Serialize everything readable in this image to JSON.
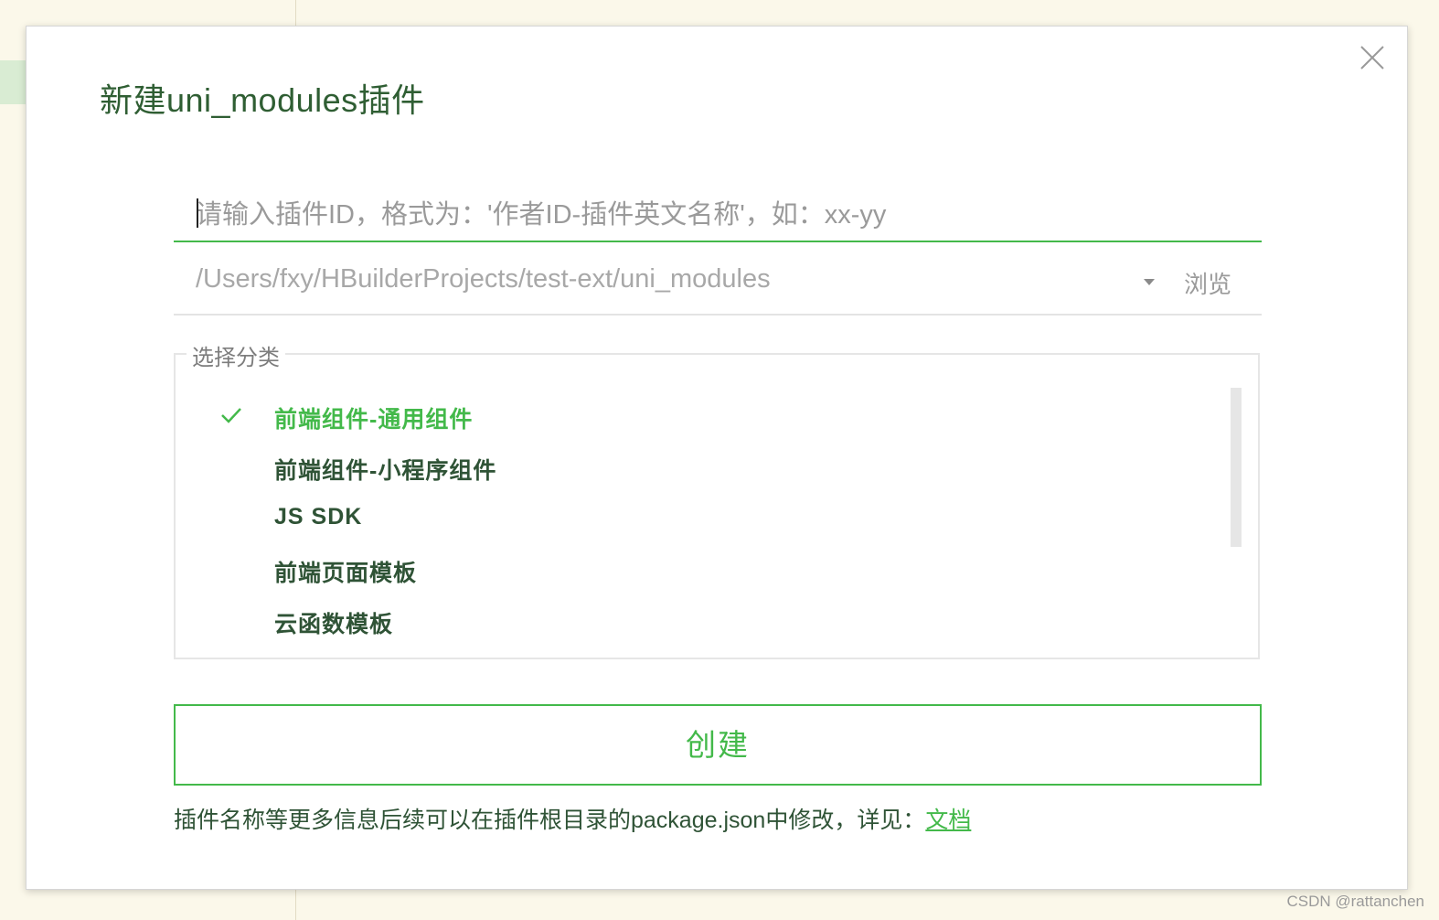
{
  "dialog": {
    "title": "新建uni_modules插件",
    "id_input": {
      "value": "",
      "placeholder": "请输入插件ID，格式为：'作者ID-插件英文名称'，如：xx-yy"
    },
    "path": {
      "value": "/Users/fxy/HBuilderProjects/test-ext/uni_modules",
      "browse_label": "浏览",
      "dropdown_icon": "caret-down-icon"
    },
    "category": {
      "legend": "选择分类",
      "selected_index": 0,
      "items": [
        {
          "label": "前端组件-通用组件",
          "selected": true
        },
        {
          "label": "前端组件-小程序组件",
          "selected": false
        },
        {
          "label": "JS SDK",
          "selected": false
        },
        {
          "label": "前端页面模板",
          "selected": false
        },
        {
          "label": "云函数模板",
          "selected": false
        }
      ]
    },
    "create_label": "创建",
    "hint": {
      "text": "插件名称等更多信息后续可以在插件根目录的package.json中修改，详见：",
      "link_label": "文档"
    },
    "close_icon": "close-icon"
  },
  "watermark": "CSDN @rattanchen",
  "colors": {
    "accent": "#43b94a",
    "title_text": "#2f5e33",
    "body_text": "#2f5336",
    "placeholder": "#9a9a9a",
    "background": "#fbf8ea"
  }
}
